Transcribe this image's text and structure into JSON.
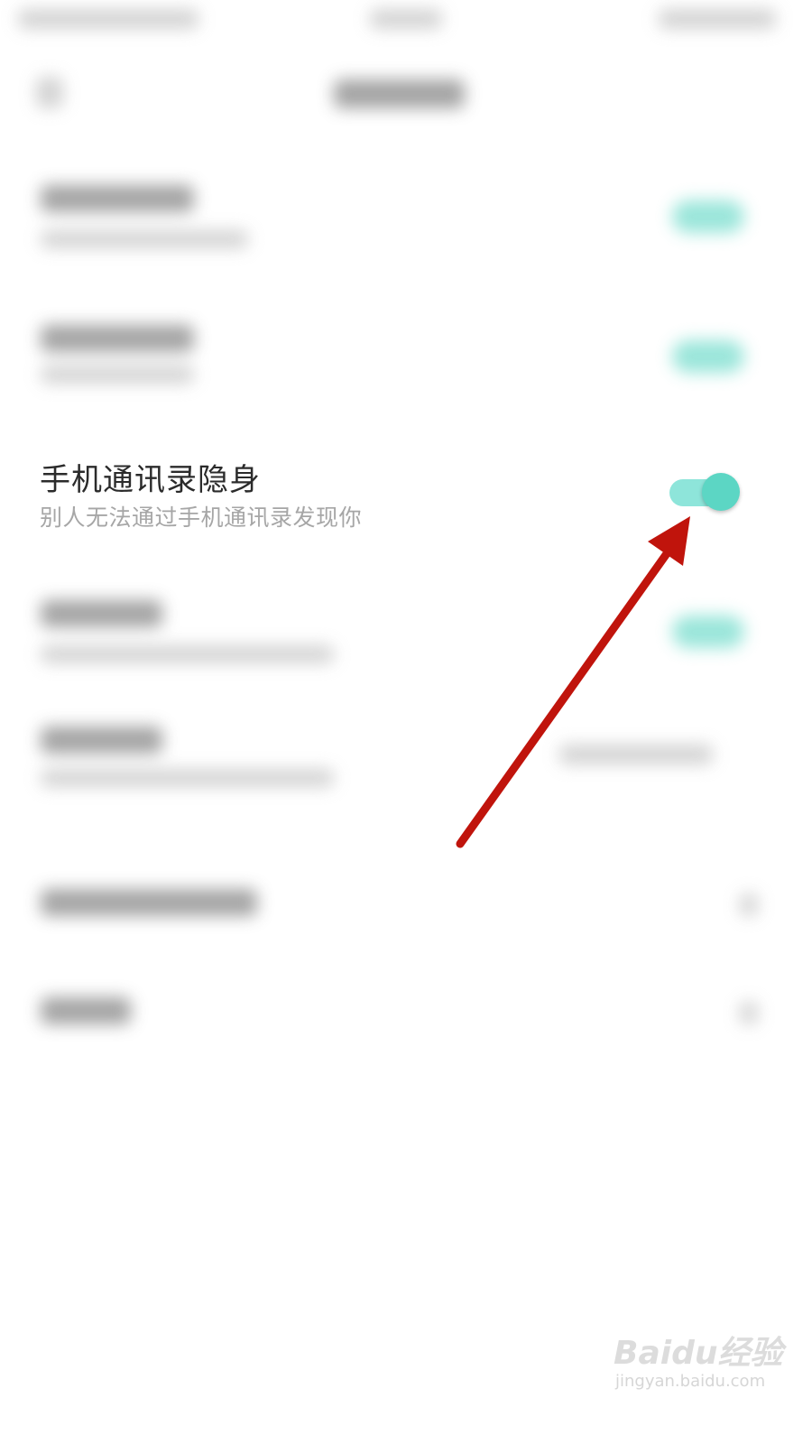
{
  "setting": {
    "title": "手机通讯录隐身",
    "subtitle": "别人无法通过手机通讯录发现你",
    "toggle_on": true
  },
  "watermark": {
    "brand": "Baidu经验",
    "url": "jingyan.baidu.com"
  },
  "colors": {
    "toggle_track": "#8ee5da",
    "toggle_knob": "#5cd6c4",
    "annotation_arrow": "#c0140c"
  },
  "icons": {
    "annotation": "red-arrow-icon"
  }
}
